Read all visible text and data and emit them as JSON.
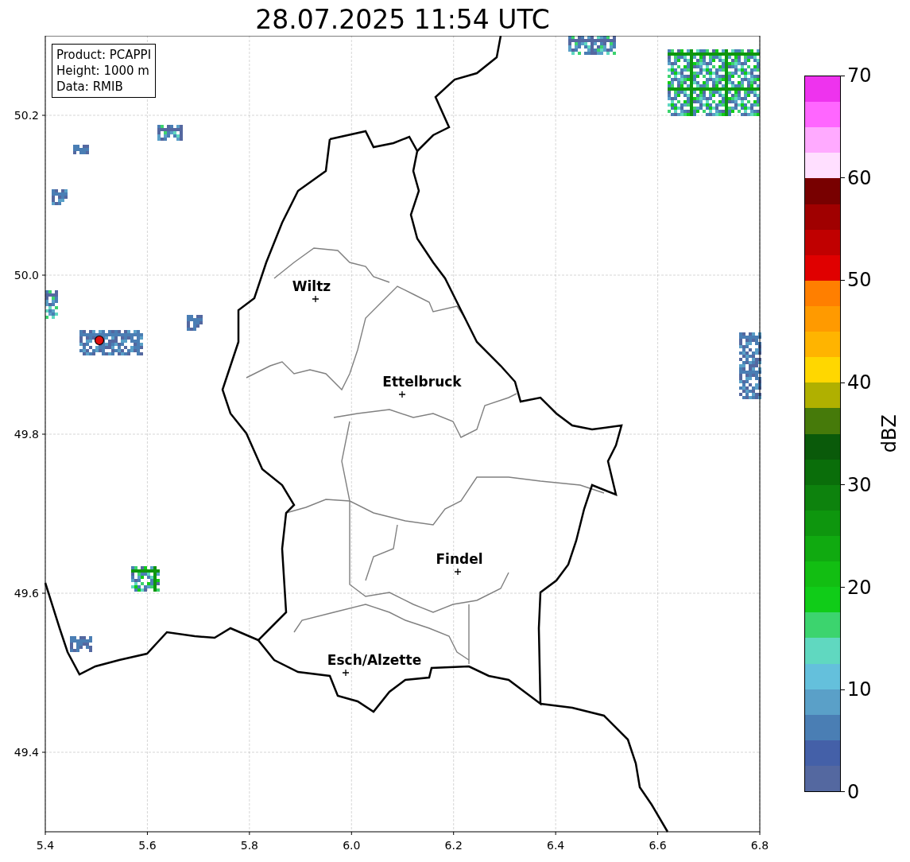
{
  "title": "28.07.2025 11:54 UTC",
  "info_box": [
    "Product: PCAPPI",
    "Height: 1000 m",
    "Data: RMIB"
  ],
  "map": {
    "x_ticks": [
      "5.4",
      "5.6",
      "5.8",
      "6.0",
      "6.2",
      "6.4",
      "6.6",
      "6.8"
    ],
    "y_ticks": [
      "50.2",
      "50.0",
      "49.8",
      "49.6",
      "49.4"
    ],
    "places": [
      {
        "name": "Wiltz"
      },
      {
        "name": "Ettelbruck"
      },
      {
        "name": "Findel"
      },
      {
        "name": "Esch/Alzette"
      }
    ]
  },
  "colorbar": {
    "label": "dBZ",
    "ticks": [
      "70",
      "60",
      "50",
      "40",
      "30",
      "20",
      "10",
      "0"
    ],
    "bins": [
      {
        "color": "#ee33ee"
      },
      {
        "color": "#ff66ff"
      },
      {
        "color": "#ffaaff"
      },
      {
        "color": "#ffdfff"
      },
      {
        "color": "#780000"
      },
      {
        "color": "#a00000"
      },
      {
        "color": "#c00000"
      },
      {
        "color": "#e00000"
      },
      {
        "color": "#ff7f00"
      },
      {
        "color": "#ff9a00"
      },
      {
        "color": "#ffb400"
      },
      {
        "color": "#ffd700"
      },
      {
        "color": "#b0b000"
      },
      {
        "color": "#467a0a"
      },
      {
        "color": "#0a5a0a"
      },
      {
        "color": "#0a6e0a"
      },
      {
        "color": "#0d820d"
      },
      {
        "color": "#0e960e"
      },
      {
        "color": "#10aa10"
      },
      {
        "color": "#12be12"
      },
      {
        "color": "#10cc18"
      },
      {
        "color": "#3cd46e"
      },
      {
        "color": "#60d8c0"
      },
      {
        "color": "#64c0dc"
      },
      {
        "color": "#5aa0c8"
      },
      {
        "color": "#4a7eb4"
      },
      {
        "color": "#4460a8"
      },
      {
        "color": "#5468a0"
      }
    ]
  }
}
